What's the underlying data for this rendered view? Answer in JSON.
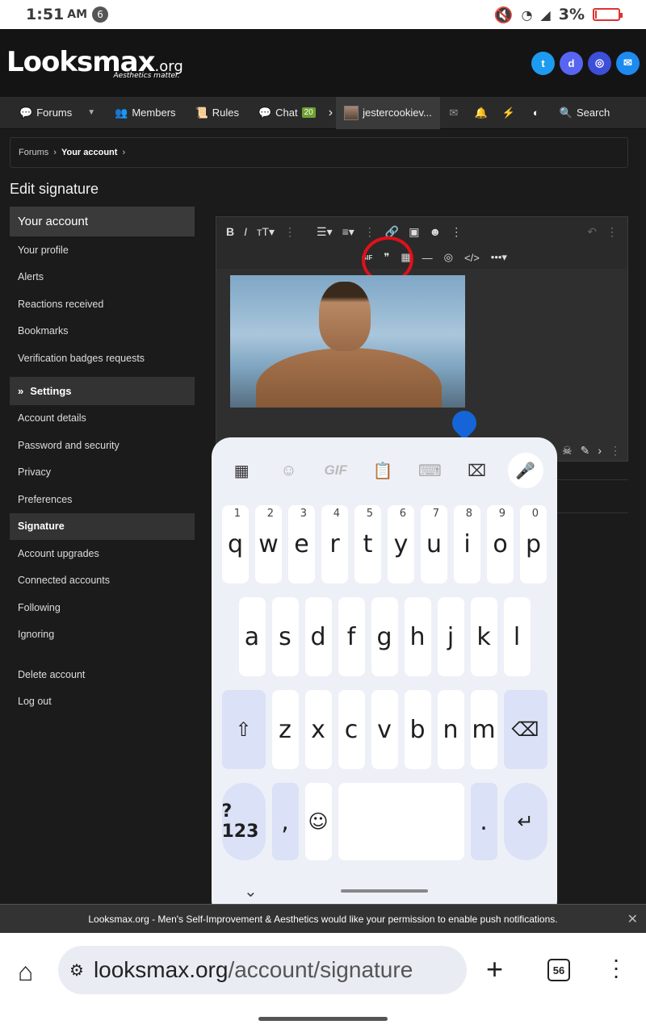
{
  "status": {
    "time": "1:51",
    "ampm": "AM",
    "notif_count": "6",
    "battery": "3%"
  },
  "header": {
    "logo": "Looksmax",
    "logo_org": ".org",
    "tagline": "Aesthetics matter."
  },
  "nav": {
    "forums": "Forums",
    "members": "Members",
    "rules": "Rules",
    "chat": "Chat",
    "chat_badge": "20",
    "user": "jestercookiev...",
    "search": "Search"
  },
  "breadcrumb": {
    "forums": "Forums",
    "account": "Your account"
  },
  "page": {
    "title": "Edit signature"
  },
  "sidebar": {
    "your_account": "Your account",
    "items1": [
      "Your profile",
      "Alerts",
      "Reactions received",
      "Bookmarks",
      "Verification badges requests"
    ],
    "settings": "Settings",
    "items2": [
      "Account details",
      "Password and security",
      "Privacy",
      "Preferences",
      "Signature",
      "Account upgrades",
      "Connected accounts",
      "Following",
      "Ignoring"
    ],
    "items3": [
      "Delete account",
      "Log out"
    ]
  },
  "editor": {
    "gif_label": "GIF"
  },
  "keyboard": {
    "gif": "GIF",
    "row1": [
      "q",
      "w",
      "e",
      "r",
      "t",
      "y",
      "u",
      "i",
      "o",
      "p"
    ],
    "row1_nums": [
      "1",
      "2",
      "3",
      "4",
      "5",
      "6",
      "7",
      "8",
      "9",
      "0"
    ],
    "row2": [
      "a",
      "s",
      "d",
      "f",
      "g",
      "h",
      "j",
      "k",
      "l"
    ],
    "row3": [
      "z",
      "x",
      "c",
      "v",
      "b",
      "n",
      "m"
    ],
    "symbols": "?123",
    "comma": ",",
    "period": "."
  },
  "cookie": {
    "text": "Looksmax.org - Men's Self-Improvement & Aesthetics would like your permission to enable push notifications."
  },
  "browser": {
    "url_host": "looksmax.org",
    "url_path": "/account/signature",
    "tab_count": "56"
  }
}
